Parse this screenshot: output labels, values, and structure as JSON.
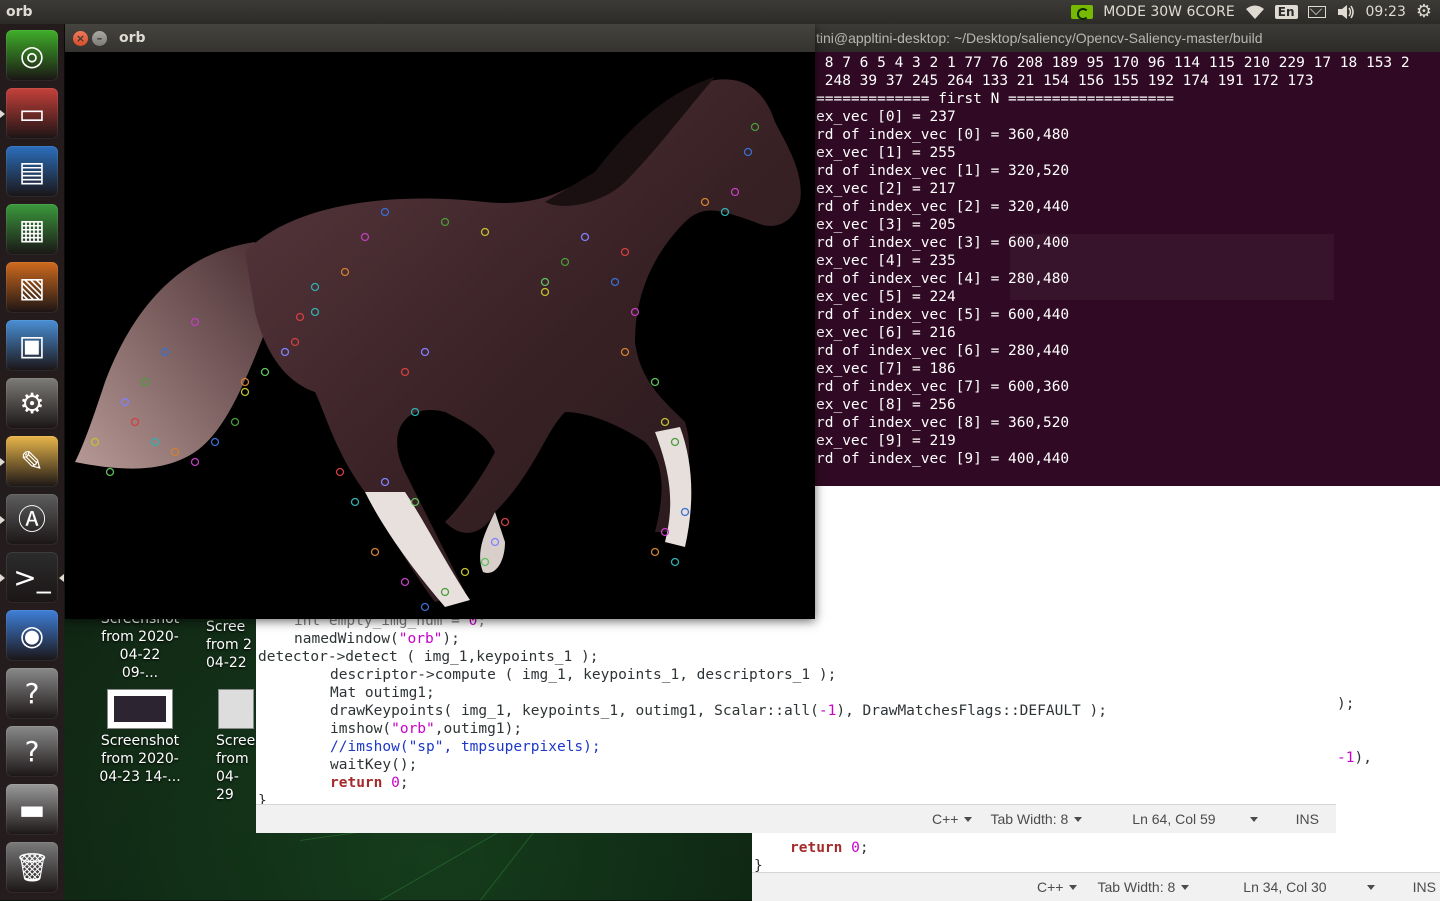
{
  "top_panel": {
    "app_title": "orb",
    "gpu_mode": "MODE 30W 6CORE",
    "keyboard_lang": "En",
    "clock": "09:23",
    "icons": [
      "nvidia-icon",
      "wifi-icon",
      "keyboard-icon",
      "mail-icon",
      "volume-icon",
      "power-gear-icon"
    ]
  },
  "launcher": {
    "items": [
      {
        "name": "ubuntu-dash",
        "glyph": "◎",
        "color": "#3fae29"
      },
      {
        "name": "files",
        "glyph": "▭",
        "color": "#c6403a"
      },
      {
        "name": "libreoffice-writer",
        "glyph": "▤",
        "color": "#2b6fbd"
      },
      {
        "name": "libreoffice-calc",
        "glyph": "▦",
        "color": "#3b9a3d"
      },
      {
        "name": "libreoffice-impress",
        "glyph": "▧",
        "color": "#cf6a1e"
      },
      {
        "name": "software-center",
        "glyph": "▣",
        "color": "#4a8fd6"
      },
      {
        "name": "system-settings",
        "glyph": "⚙",
        "color": "#7d7c78"
      },
      {
        "name": "text-editor",
        "glyph": "✎",
        "color": "#e8b64a"
      },
      {
        "name": "software-updater",
        "glyph": "Ⓐ",
        "color": "#5e5e5e"
      },
      {
        "name": "terminal",
        "glyph": ">_",
        "color": "#2c2c2c"
      },
      {
        "name": "chromium",
        "glyph": "◉",
        "color": "#3f7fd9"
      },
      {
        "name": "unknown-app-1",
        "glyph": "?",
        "color": "#8a8a8a"
      },
      {
        "name": "unknown-app-2",
        "glyph": "?",
        "color": "#8a8a8a"
      },
      {
        "name": "drive",
        "glyph": "▬",
        "color": "#9a9a9a"
      },
      {
        "name": "trash",
        "glyph": "🗑",
        "color": "#7a7a7a"
      }
    ]
  },
  "desktop_icons": [
    {
      "line1": "Screenshot",
      "line2": "from 2020-",
      "line3": "04-22 09-..."
    },
    {
      "line1": "Scree",
      "line2": "from 2",
      "line3": "04-22"
    },
    {
      "line1": "Screenshot",
      "line2": "from 2020-",
      "line3": "04-23 14-..."
    },
    {
      "line1": "Scree",
      "line2": "from",
      "line3": "04-29"
    }
  ],
  "orb_window": {
    "title": "orb"
  },
  "terminal": {
    "title": "tini@appltini-desktop: ~/Desktop/saliency/Opencv-Saliency-master/build",
    "lines": [
      " 8 7 6 5 4 3 2 1 77 76 208 189 95 170 96 114 115 210 229 17 18 153 2",
      " 248 39 37 245 264 133 21 154 156 155 192 174 191 172 173",
      "============= first N ===================",
      "ex_vec [0] = 237",
      "rd of index_vec [0] = 360,480",
      "ex_vec [1] = 255",
      "rd of index_vec [1] = 320,520",
      "ex_vec [2] = 217",
      "rd of index_vec [2] = 320,440",
      "ex_vec [3] = 205",
      "rd of index_vec [3] = 600,400",
      "ex_vec [4] = 235",
      "rd of index_vec [4] = 280,480",
      "ex_vec [5] = 224",
      "rd of index_vec [5] = 600,440",
      "ex_vec [6] = 216",
      "rd of index_vec [6] = 280,440",
      "ex_vec [7] = 186",
      "rd of index_vec [7] = 600,360",
      "ex_vec [8] = 256",
      "rd of index_vec [8] = 360,520",
      "ex_vec [9] = 219",
      "rd of index_vec [9] = 400,440"
    ]
  },
  "editor_front": {
    "code": {
      "l0a": "int empty_img_num = ",
      "l0b": "0",
      "l0c": ";",
      "l1a": "namedWindow(",
      "l1b": "\"orb\"",
      "l1c": ");",
      "l2": "detector->detect ( img_1,keypoints_1 );",
      "l3": "descriptor->compute ( img_1, keypoints_1, descriptors_1 );",
      "l4": "Mat outimg1;",
      "l5a": "drawKeypoints( img_1, keypoints_1, outimg1, Scalar::all(",
      "l5b": "-1",
      "l5c": "), DrawMatchesFlags::DEFAULT );",
      "l6a": "imshow(",
      "l6b": "\"orb\"",
      "l6c": ",outimg1);",
      "l7": "//imshow(\"sp\", tmpsuperpixels);",
      "l8": "waitKey();",
      "l9a": "return",
      "l9b": "0",
      "l9c": ";",
      "l10": "}",
      "right1": ");",
      "right2a": "-1",
      "right2b": "),"
    },
    "status": {
      "language": "C++",
      "tab_width": "Tab Width: 8",
      "position": "Ln 64, Col 59",
      "mode": "INS"
    }
  },
  "editor_back": {
    "code": {
      "ret_kw": "return",
      "ret_num": "0",
      "ret_semi": ";",
      "brace": "}"
    },
    "status": {
      "language": "C++",
      "tab_width": "Tab Width: 8",
      "position": "Ln 34, Col 30",
      "mode": "INS"
    }
  },
  "colors": {
    "terminal_bg": "#300a24",
    "panel_bg": "#2c2b28",
    "close_button": "#e05a34",
    "code_string": "#c800c8",
    "code_keyword": "#a52a2a",
    "code_comment": "#1d38c8"
  }
}
